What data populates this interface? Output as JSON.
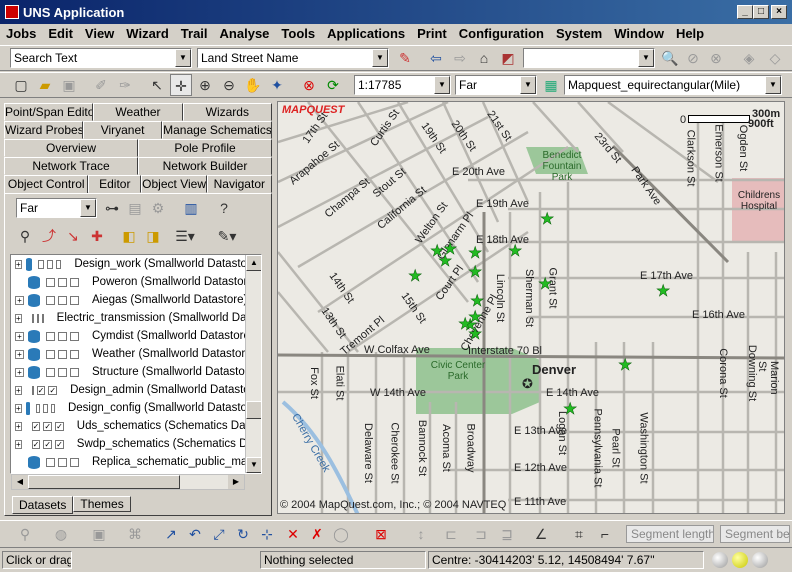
{
  "window": {
    "title": "UNS Application"
  },
  "menu": [
    "Jobs",
    "Edit",
    "View",
    "Wizard",
    "Trail",
    "Analyse",
    "Tools",
    "Applications",
    "Print",
    "Configuration",
    "System",
    "Window",
    "Help"
  ],
  "toolbar1": {
    "search_value": "Search Text",
    "search_mode": "Land Street Name"
  },
  "toolbar2": {
    "scale": "1:17785",
    "range": "Far",
    "projection": "Mapquest_equirectangular(Mile)"
  },
  "tabs": {
    "row1": [
      "Point/Span Editor",
      "Weather",
      "Wizards"
    ],
    "row2": [
      "Wizard Probes",
      "Viryanet",
      "Manage Schematics"
    ],
    "row3": [
      "Overview",
      "Pole Profile"
    ],
    "row4": [
      "Network Trace",
      "Network Builder"
    ],
    "row5": [
      "Object Control",
      "Editor",
      "Object View",
      "Navigator"
    ]
  },
  "panel": {
    "range_value": "Far"
  },
  "datasets": [
    {
      "label": "Design_work (Smallworld Datastore)",
      "expand": true,
      "checks": [
        "",
        "",
        ""
      ]
    },
    {
      "label": "Poweron (Smallworld Datastore)",
      "expand": false,
      "checks": [
        "",
        "",
        ""
      ]
    },
    {
      "label": "Aiegas (Smallworld Datastore)",
      "expand": true,
      "checks": [
        "",
        "",
        ""
      ]
    },
    {
      "label": "Electric_transmission (Smallworld Datastore)",
      "expand": true,
      "checks": [
        "",
        "",
        ""
      ]
    },
    {
      "label": "Cymdist (Smallworld Datastore)",
      "expand": true,
      "checks": [
        "",
        "",
        ""
      ]
    },
    {
      "label": "Weather (Smallworld Datastore)",
      "expand": true,
      "checks": [
        "",
        "",
        ""
      ]
    },
    {
      "label": "Structure (Smallworld Datastore)",
      "expand": true,
      "checks": [
        "",
        "",
        ""
      ]
    },
    {
      "label": "Design_admin (Smallworld Datastore)",
      "expand": true,
      "checks": [
        "",
        "✓",
        "✓"
      ]
    },
    {
      "label": "Design_config (Smallworld Datastore)",
      "expand": true,
      "checks": [
        "",
        "",
        ""
      ]
    },
    {
      "label": "Uds_schematics (Schematics Datastore)",
      "expand": true,
      "checks": [
        "✓",
        "✓",
        "✓"
      ]
    },
    {
      "label": "Swdp_schematics (Schematics Datastore)",
      "expand": true,
      "checks": [
        "✓",
        "✓",
        "✓"
      ]
    },
    {
      "label": "Replica_schematic_public_ma",
      "expand": false,
      "checks": [
        "",
        "",
        ""
      ]
    }
  ],
  "bottom_tabs": [
    "Datasets",
    "Themes"
  ],
  "map": {
    "logo": "MAPQUEST",
    "copyright": "© 2004 MapQuest.com, Inc.; © 2004 NAVTEQ",
    "scale_m": "300m",
    "scale_ft": "900ft",
    "scale_zero": "0",
    "city": "Denver",
    "labels": {
      "a": "17th St",
      "b": "Curtis St",
      "c": "19th St",
      "d": "20th St",
      "e": "21st St",
      "f": "23rd St",
      "g": "Arapahoe St",
      "h": "Champa St",
      "i": "Stout St",
      "j": "California St",
      "k": "Welton St",
      "l": "Glenarm Pl",
      "m": "Court Pl",
      "n": "Cheyenne Pl",
      "o": "14th St",
      "p": "13th St",
      "q": "15th St",
      "r": "Tremont Pl",
      "s": "W Colfax Ave",
      "t": "Interstate 70 Bl",
      "u": "W 14th Ave",
      "v": "E 14th Ave",
      "w": "E 13th Ave",
      "x": "E 12th Ave",
      "y": "E 11th Ave",
      "z": "E 20th Ave",
      "aa": "E 19th Ave",
      "ab": "E 18th Ave",
      "ac": "E 17th Ave",
      "ad": "E 16th Ave",
      "ae": "Lincoln St",
      "af": "Sherman St",
      "ag": "Grant St",
      "ah": "Clarkson St",
      "ai": "Emerson St",
      "aj": "Ogden St",
      "ak": "Park Ave",
      "al": "Childrens Hospital",
      "am": "Benedict Fountain Park",
      "an": "Civic Center Park",
      "ao": "Fox St",
      "ap": "Elati St",
      "aq": "Delaware St",
      "ar": "Cherokee St",
      "as": "Bannock St",
      "at": "Acoma St",
      "au": "Broadway",
      "av": "Logan St",
      "aw": "Pennsylvania St",
      "ax": "Pearl St",
      "ay": "Washington St",
      "az": "Corona St",
      "ba": "Downing St",
      "bb": "Marion St",
      "bc": "Cherry Creek"
    }
  },
  "toolbar_bottom": {
    "segment_length": "Segment length",
    "segment_bearing": "Segment bear"
  },
  "status": {
    "hint": "Click or drag t",
    "selection": "Nothing selected",
    "centre": "Centre: -30414203' 5.12, 14508494' 7.67''"
  }
}
